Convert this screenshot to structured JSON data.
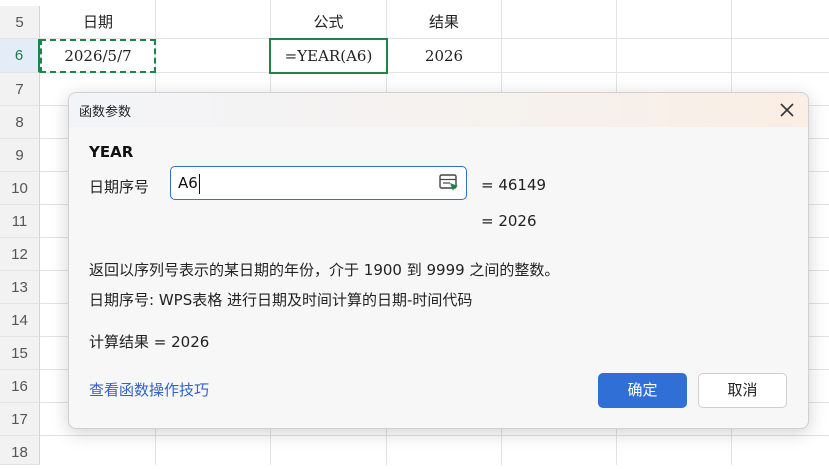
{
  "sheet": {
    "rows": [
      "5",
      "6",
      "7",
      "8",
      "9",
      "10",
      "11",
      "12",
      "13",
      "14",
      "15",
      "16",
      "17",
      "18"
    ],
    "headers": {
      "date": "日期",
      "formula": "公式",
      "result": "结果"
    },
    "row6": {
      "date": "2026/5/7",
      "formula": "=YEAR(A6)",
      "result": "2026"
    }
  },
  "dialog": {
    "title": "函数参数",
    "function_name": "YEAR",
    "arg_label": "日期序号",
    "arg_value": "A6",
    "arg_eval": "=  46149",
    "fn_eval": "=  2026",
    "description": "返回以序列号表示的某日期的年份，介于 1900 到 9999 之间的整数。",
    "arg_description": "日期序号:  WPS表格 进行日期及时间计算的日期-时间代码",
    "result_label": "计算结果  =  2026",
    "help_link": "查看函数操作技巧",
    "ok_label": "确定",
    "cancel_label": "取消"
  },
  "colors": {
    "accent": "#2f6fd6",
    "selection": "#1e8449",
    "link": "#2f63c9"
  },
  "icons": {
    "close": "close-icon",
    "range_picker": "range-select-icon"
  }
}
